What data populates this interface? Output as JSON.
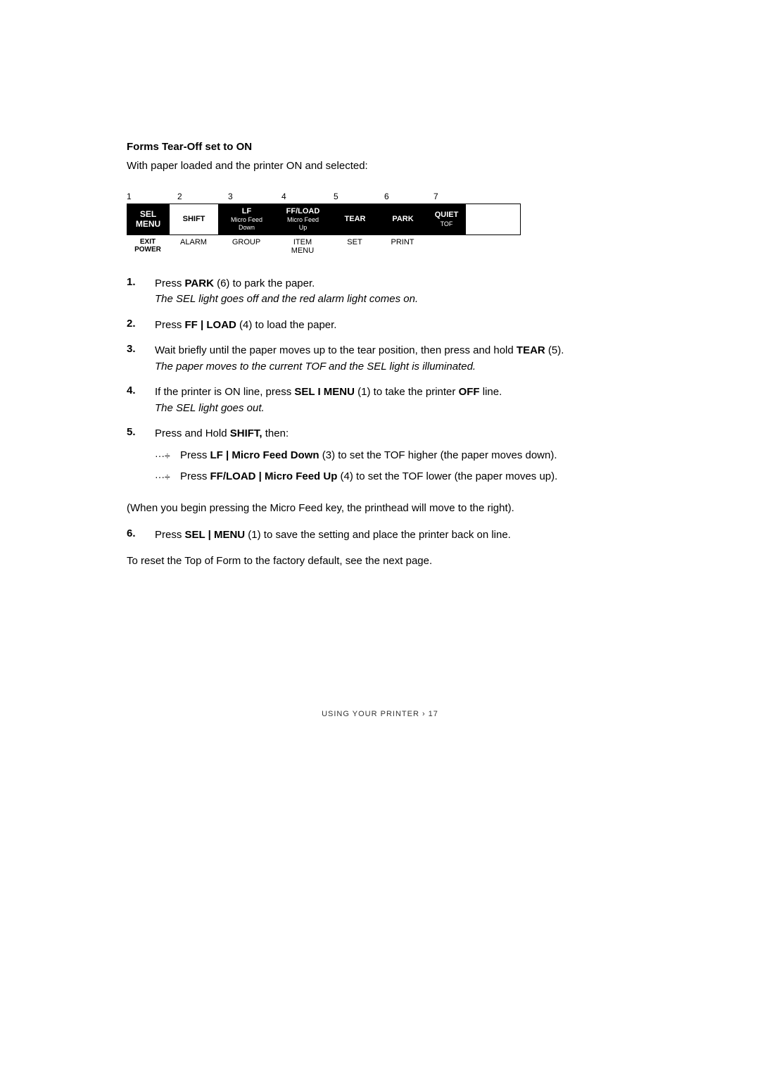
{
  "page": {
    "section_title": "Forms Tear-Off set to ON",
    "intro_text": "With paper loaded and the printer ON and selected:",
    "keyboard": {
      "numbers": [
        "1",
        "2",
        "3",
        "4",
        "5",
        "6",
        "7"
      ],
      "keys": [
        {
          "id": "sel",
          "top": "SEL",
          "bottom": "MENU",
          "style": "dark"
        },
        {
          "id": "shift",
          "top": "SHIFT",
          "bottom": "",
          "style": "light"
        },
        {
          "id": "lf",
          "top": "LF",
          "sub": "Micro Feed Down",
          "style": "dark"
        },
        {
          "id": "ff",
          "top": "FF/LOAD",
          "sub": "Micro Feed Up",
          "style": "dark"
        },
        {
          "id": "tear",
          "top": "TEAR",
          "sub": "",
          "style": "dark"
        },
        {
          "id": "park",
          "top": "PARK",
          "sub": "",
          "style": "dark"
        },
        {
          "id": "quiet",
          "top": "QUIET",
          "sub": "TOF",
          "style": "dark"
        }
      ],
      "labels_row1": [
        "EXIT",
        "ALARM",
        "GROUP",
        "ITEM",
        "SET",
        "PRINT",
        ""
      ],
      "labels_row2": [
        "POWER",
        "",
        "",
        "MENU",
        "",
        "",
        ""
      ]
    },
    "steps": [
      {
        "num": "1.",
        "main": "Press PARK (6) to park the paper.",
        "main_bold": "PARK",
        "italic": "The SEL light goes off and the red alarm light comes on."
      },
      {
        "num": "2.",
        "main": "Press FF | LOAD (4) to load the paper.",
        "main_bold": "FF | LOAD"
      },
      {
        "num": "3.",
        "main": "Wait briefly until the paper moves up to the tear position, then press and hold TEAR (5).",
        "main_bold": "TEAR",
        "italic": "The paper moves to the current TOF and the SEL light is illuminated."
      },
      {
        "num": "4.",
        "main": "If the printer is ON line, press SEL I MENU (1) to take the printer OFF line.",
        "main_bold_1": "SEL I MENU",
        "main_bold_2": "OFF",
        "italic": "The SEL light goes out."
      },
      {
        "num": "5.",
        "main": "Press and Hold SHIFT, then:",
        "main_bold": "SHIFT",
        "sub_steps": [
          {
            "bullet": "···÷",
            "text": "Press LF | Micro Feed Down (3) to set the TOF higher (the paper moves down).",
            "bold": "LF | Micro Feed Down"
          },
          {
            "bullet": "···÷",
            "text": "Press FF/LOAD | Micro Feed Up (4) to set the TOF lower (the paper moves up).",
            "bold": "FF/LOAD | Micro Feed Up"
          }
        ]
      }
    ],
    "note": "(When you begin pressing the Micro Feed key, the printhead will move to the right).",
    "step6": {
      "num": "6.",
      "main": "Press SEL | MENU (1) to save the setting and place the printer back on line.",
      "main_bold": "SEL | MENU"
    },
    "footer_note": "To reset the Top of Form to the factory default, see the next page.",
    "page_footer": "USING YOUR PRINTER › 17"
  }
}
